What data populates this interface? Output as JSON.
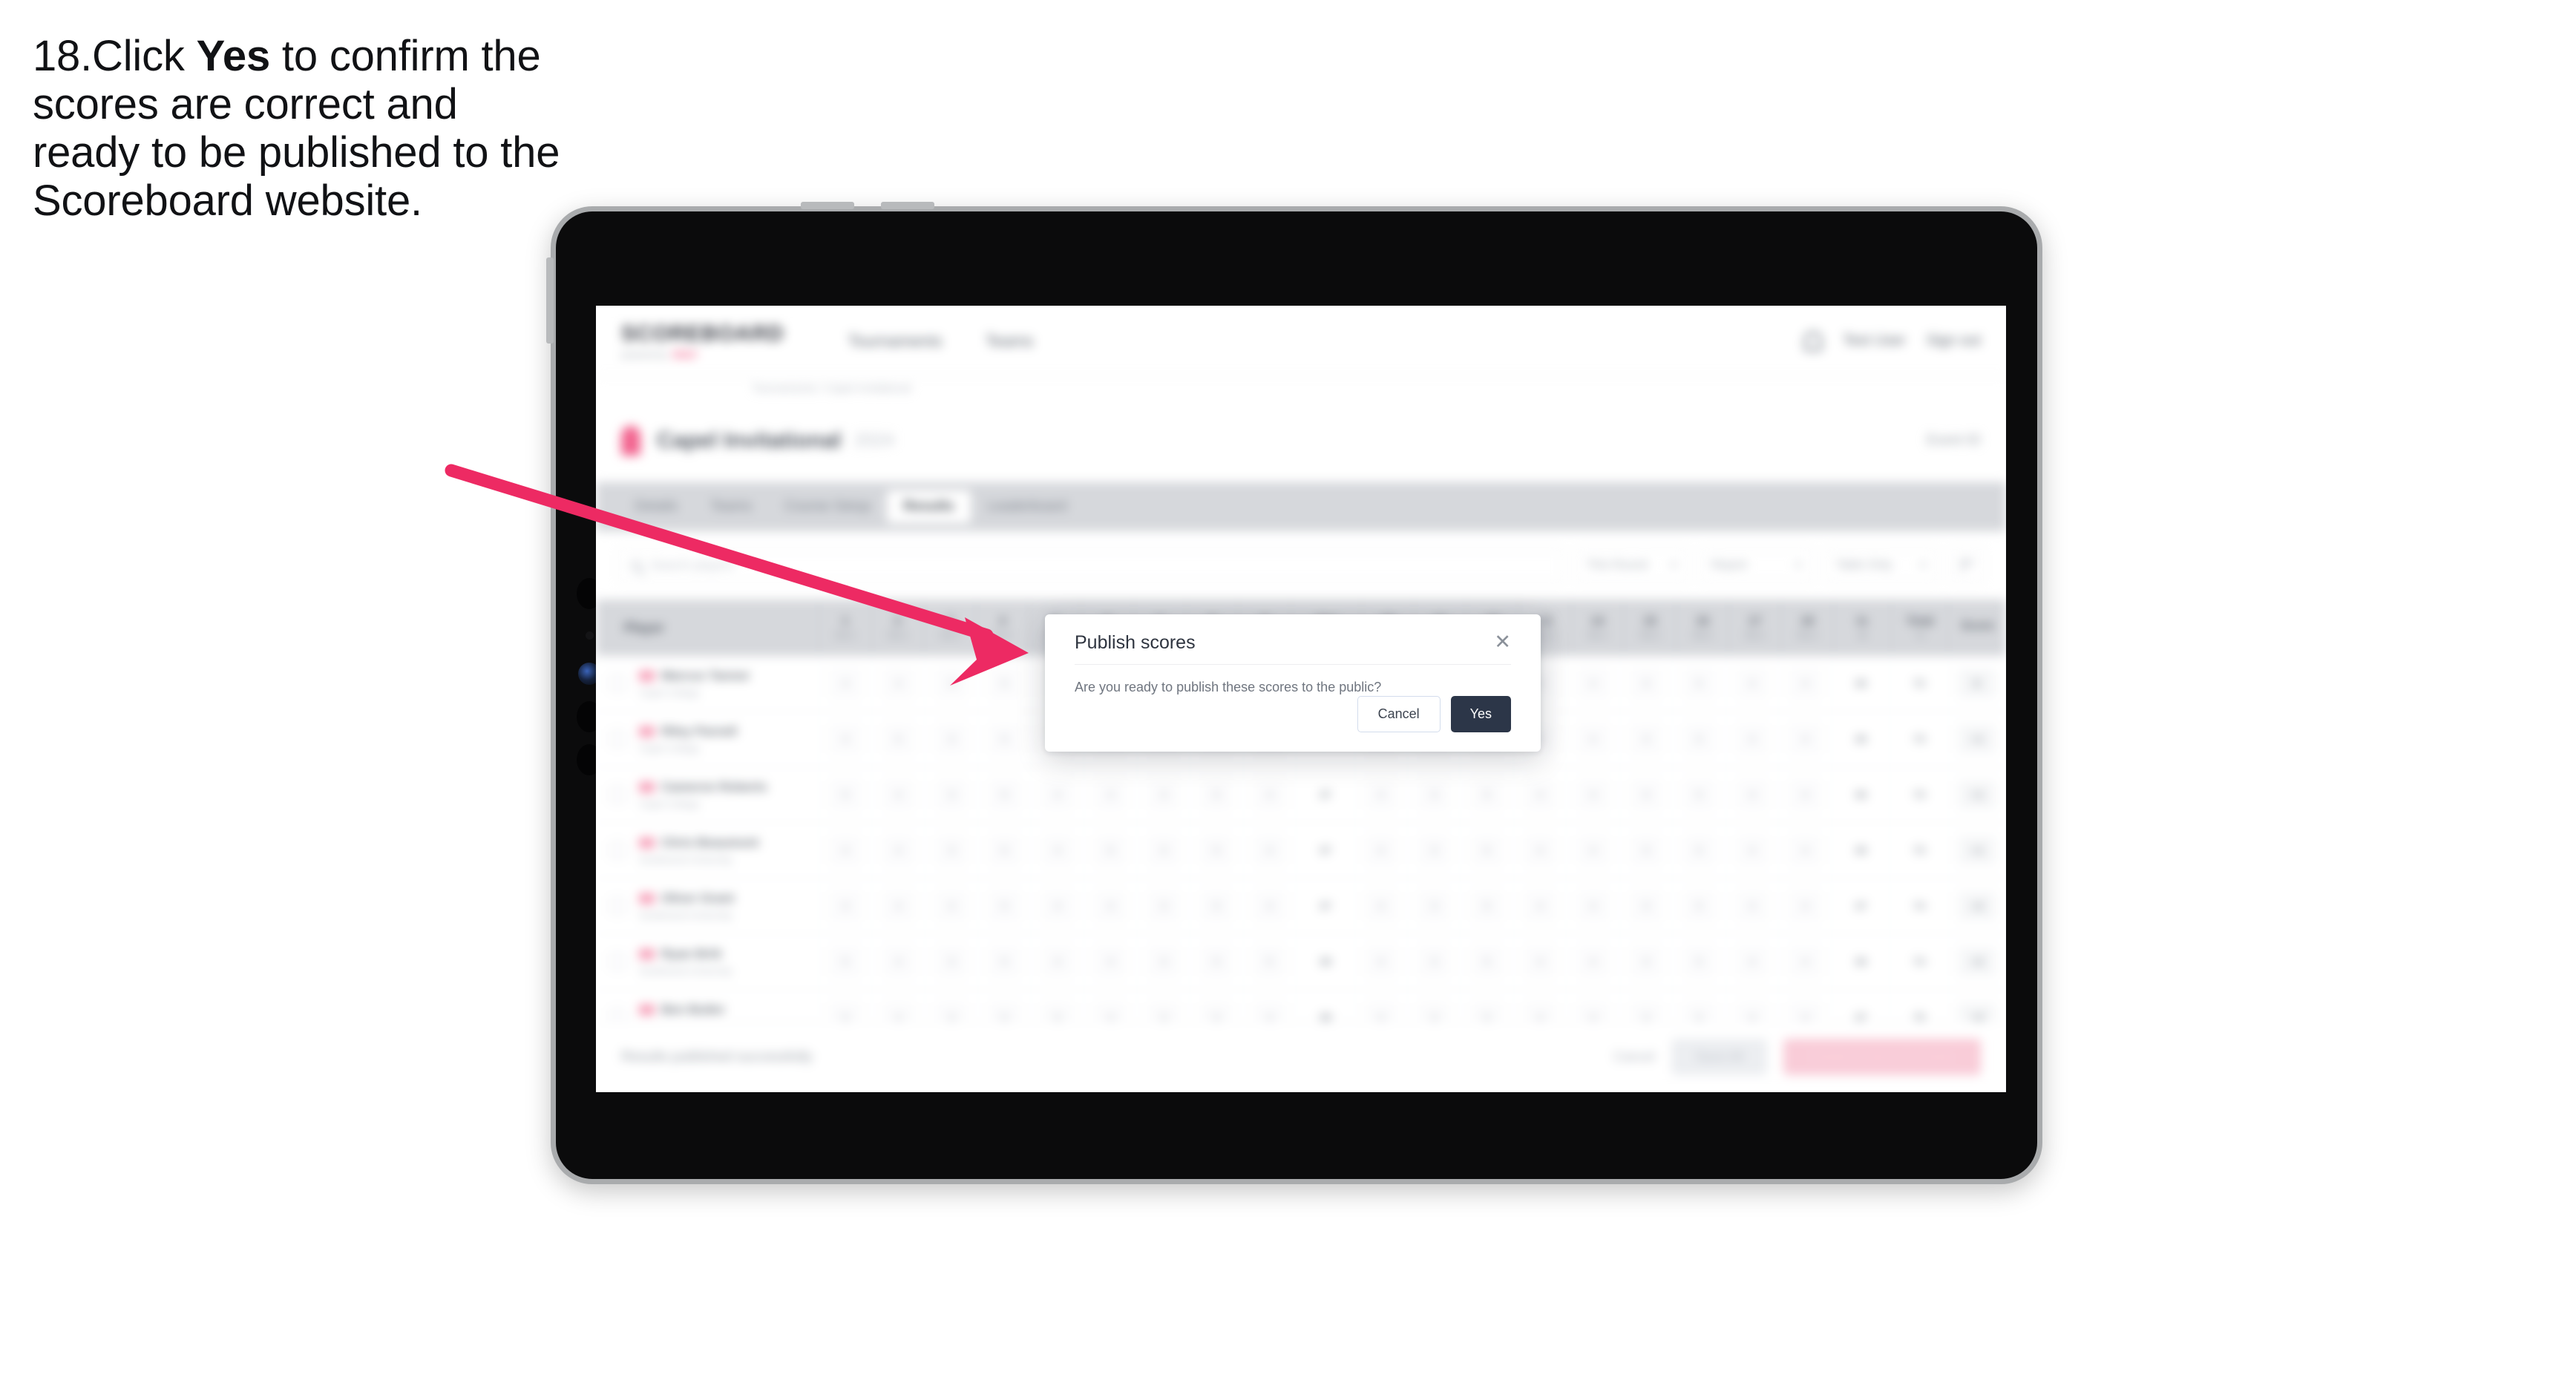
{
  "caption": {
    "number": "18.",
    "pre": "Click ",
    "bold": "Yes",
    "post": " to confirm the scores are correct and ready to be published to the Scoreboard website."
  },
  "colors": {
    "accent_pink": "#ED2A63",
    "modal_primary": "#2C3648",
    "tablet_frame": "#A9ABAD",
    "tablet_bezel": "#0B0B0C",
    "tab_strip": "#D6D8DC"
  },
  "app": {
    "brand": {
      "name": "SCOREBOARD",
      "sub_prefix": "powered by",
      "sub_tag": "GOLF"
    },
    "top_nav": [
      {
        "label": "Tournaments"
      },
      {
        "label": "Teams"
      }
    ],
    "header_right": {
      "bell_icon": "bell-icon",
      "user_label": "Test User",
      "signout_label": "Sign out"
    },
    "breadcrumb": "Tournaments / Capel Invitational",
    "title": {
      "mark_icon": "trophy-icon",
      "text": "Capel Invitational",
      "badge": "2024",
      "right_label": "Event ID"
    },
    "tabs": [
      {
        "label": "Details",
        "active": false
      },
      {
        "label": "Teams",
        "active": false
      },
      {
        "label": "Course Setup",
        "active": false
      },
      {
        "label": "Results",
        "active": true
      },
      {
        "label": "Leaderboard",
        "active": false
      }
    ],
    "toolbar": {
      "search_placeholder": "Search players",
      "dropdown_round": "This Round",
      "dropdown_report": "Report",
      "dropdown_view": "Table Only",
      "filter_icon": "filter-icon"
    },
    "table": {
      "player_header": "Player",
      "hole_headers": [
        {
          "n": "1",
          "p": "Par 4"
        },
        {
          "n": "2",
          "p": "Par 4"
        },
        {
          "n": "3",
          "p": "Par 3"
        },
        {
          "n": "4",
          "p": "Par 5"
        },
        {
          "n": "5",
          "p": "Par 4"
        },
        {
          "n": "6",
          "p": "Par 4"
        },
        {
          "n": "7",
          "p": "Par 3"
        },
        {
          "n": "8",
          "p": "Par 5"
        },
        {
          "n": "9",
          "p": "Par 4"
        },
        {
          "n": "Out",
          "p": "36"
        },
        {
          "n": "10",
          "p": "Par 4"
        },
        {
          "n": "11",
          "p": "Par 3"
        },
        {
          "n": "12",
          "p": "Par 5"
        },
        {
          "n": "13",
          "p": "Par 4"
        },
        {
          "n": "14",
          "p": "Par 4"
        },
        {
          "n": "15",
          "p": "Par 3"
        },
        {
          "n": "16",
          "p": "Par 5"
        },
        {
          "n": "17",
          "p": "Par 4"
        },
        {
          "n": "18",
          "p": "Par 4"
        }
      ],
      "tail_headers": [
        {
          "n": "In",
          "p": "36"
        },
        {
          "n": "Total",
          "p": "72"
        },
        {
          "n": "Score",
          "p": ""
        }
      ],
      "rows": [
        {
          "name": "Marcus Tanner",
          "team": "Capel College",
          "scores": [
            "4",
            "4",
            "3",
            "5",
            "4",
            "4",
            "3",
            "5",
            "4"
          ],
          "out": "36",
          "in2": [
            "4",
            "3",
            "5",
            "4",
            "4",
            "3",
            "5",
            "4",
            "4"
          ],
          "in": "36",
          "total": "72",
          "score": "E"
        },
        {
          "name": "Riley Parnell",
          "team": "Capel College",
          "scores": [
            "4",
            "5",
            "3",
            "5",
            "4",
            "4",
            "3",
            "5",
            "4"
          ],
          "out": "37",
          "in2": [
            "4",
            "3",
            "5",
            "4",
            "4",
            "3",
            "5",
            "4",
            "4"
          ],
          "in": "36",
          "total": "73",
          "score": "+1"
        },
        {
          "name": "Cameron Roberts",
          "team": "Capel College",
          "scores": [
            "5",
            "4",
            "3",
            "5",
            "4",
            "4",
            "3",
            "5",
            "4"
          ],
          "out": "37",
          "in2": [
            "4",
            "3",
            "5",
            "4",
            "4",
            "3",
            "5",
            "4",
            "4"
          ],
          "in": "36",
          "total": "73",
          "score": "+1"
        },
        {
          "name": "Chris Beaumont",
          "team": "Southwood University",
          "scores": [
            "4",
            "4",
            "3",
            "5",
            "4",
            "5",
            "3",
            "5",
            "4"
          ],
          "out": "37",
          "in2": [
            "4",
            "3",
            "5",
            "4",
            "4",
            "3",
            "5",
            "4",
            "4"
          ],
          "in": "36",
          "total": "73",
          "score": "+1"
        },
        {
          "name": "Oliver Grant",
          "team": "Southwood University",
          "scores": [
            "4",
            "4",
            "4",
            "5",
            "4",
            "4",
            "3",
            "5",
            "4"
          ],
          "out": "37",
          "in2": [
            "4",
            "3",
            "5",
            "4",
            "4",
            "3",
            "5",
            "4",
            "4"
          ],
          "in": "37",
          "total": "74",
          "score": "+2"
        },
        {
          "name": "Ryan Britt",
          "team": "Southwood University",
          "scores": [
            "5",
            "4",
            "3",
            "5",
            "4",
            "4",
            "3",
            "5",
            "5"
          ],
          "out": "38",
          "in2": [
            "4",
            "3",
            "5",
            "4",
            "4",
            "3",
            "5",
            "4",
            "4"
          ],
          "in": "36",
          "total": "74",
          "score": "+2"
        },
        {
          "name": "Ben Butler",
          "team": "Southwood University",
          "scores": [
            "5",
            "4",
            "3",
            "5",
            "5",
            "4",
            "3",
            "5",
            "4"
          ],
          "out": "38",
          "in2": [
            "4",
            "3",
            "5",
            "4",
            "4",
            "3",
            "5",
            "4",
            "4"
          ],
          "in": "37",
          "total": "75",
          "score": "+3"
        }
      ]
    },
    "footer": {
      "status": "Results published successfully",
      "cancel_label": "Cancel",
      "save_label": "Save All",
      "publish_label": "Publish Scores To Public"
    }
  },
  "modal": {
    "title": "Publish scores",
    "close_icon": "close-icon",
    "body": "Are you ready to publish these scores to the public?",
    "cancel_label": "Cancel",
    "confirm_label": "Yes"
  },
  "annotation": {
    "arrow_icon": "arrow-pointer",
    "color": "#ED2A63"
  }
}
